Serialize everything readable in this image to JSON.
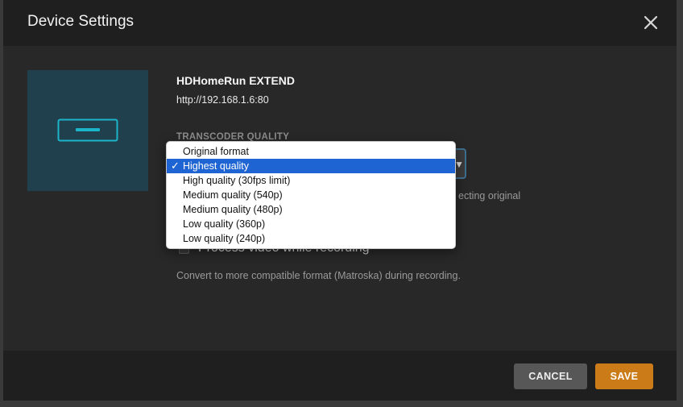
{
  "dialog": {
    "title": "Device Settings",
    "close_icon": "close-icon"
  },
  "device": {
    "icon": "tuner-device-icon",
    "name": "HDHomeRun EXTEND",
    "url": "http://192.168.1.6:80"
  },
  "transcoder": {
    "label": "TRANSCODER QUALITY",
    "selected": "Highest quality",
    "help_text": "ecting original",
    "options": [
      "Original format",
      "Highest quality",
      "High quality (30fps limit)",
      "Medium quality (540p)",
      "Medium quality (480p)",
      "Low quality (360p)",
      "Low quality (240p)"
    ],
    "selected_index": 1
  },
  "process": {
    "checkbox_label": "Process video while recording",
    "checked": false,
    "help_text": "Convert to more compatible format (Matroska) during recording."
  },
  "footer": {
    "cancel_label": "CANCEL",
    "save_label": "SAVE"
  },
  "colors": {
    "accent": "#cc7b19",
    "selection": "#1e64d2",
    "device_tile": "#21404e",
    "device_icon": "#1bb4c8"
  }
}
